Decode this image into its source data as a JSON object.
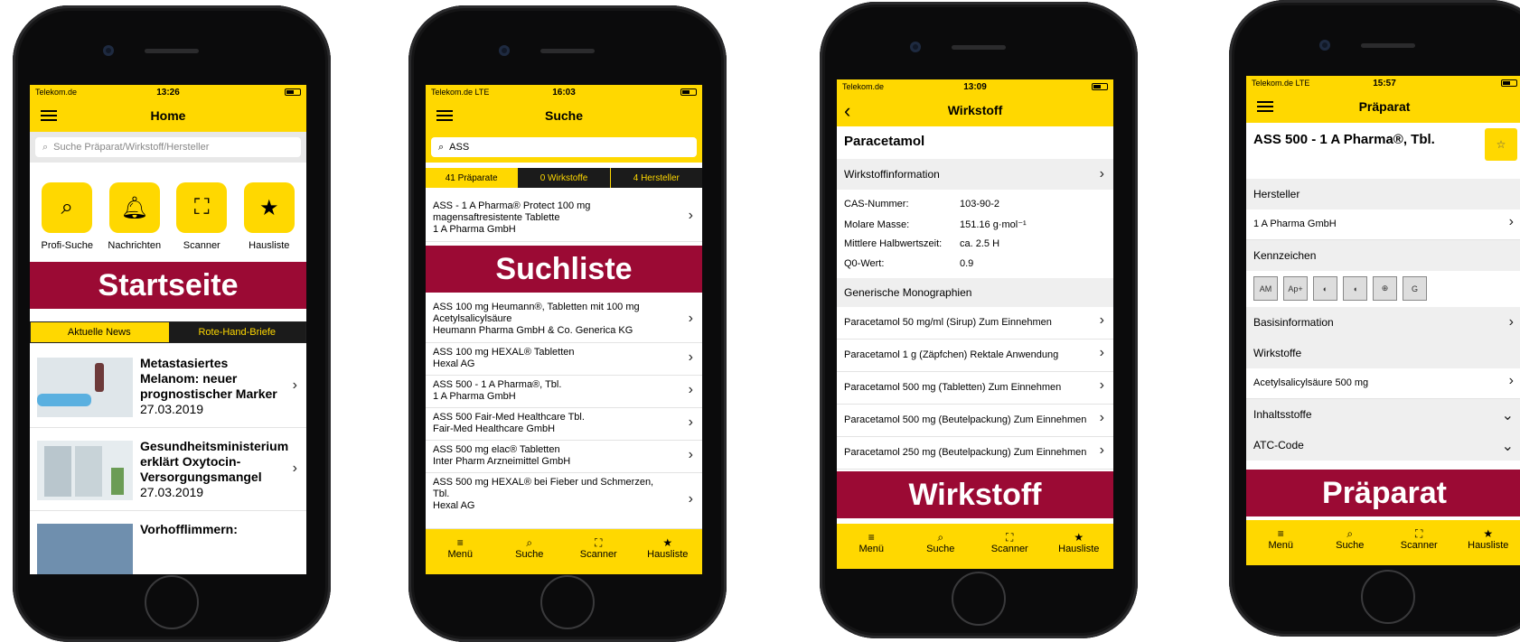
{
  "status": {
    "carrier": "Telekom.de",
    "network": "LTE"
  },
  "phones": [
    {
      "time": "13:26",
      "title": "Home"
    },
    {
      "time": "16:03",
      "title": "Suche"
    },
    {
      "time": "13:09",
      "title": "Wirkstoff"
    },
    {
      "time": "15:57",
      "title": "Präparat"
    }
  ],
  "home": {
    "search_placeholder": "Suche Präparat/Wirkstoff/Hersteller",
    "quick": [
      {
        "label": "Profi-Suche",
        "icon": "magnifier-icon"
      },
      {
        "label": "Nachrichten",
        "icon": "bell-icon"
      },
      {
        "label": "Scanner",
        "icon": "scan-frame-icon"
      },
      {
        "label": "Hausliste",
        "icon": "star-icon"
      }
    ],
    "banner": "Startseite",
    "segment": [
      "Aktuelle News",
      "Rote-Hand-Briefe"
    ],
    "news": [
      {
        "title": "Metastasiertes Melanom: neuer prognostischer Marker",
        "date": "27.03.2019"
      },
      {
        "title": "Gesundheitsministerium erklärt Oxytocin-Versorgungsmangel",
        "date": "27.03.2019"
      },
      {
        "title": "Vorhofflimmern:",
        "date": ""
      }
    ]
  },
  "suche": {
    "query": "ASS",
    "tabs": [
      "41 Präparate",
      "0 Wirkstoffe",
      "4 Hersteller"
    ],
    "banner": "Suchliste",
    "first": [
      "ASS - 1 A Pharma® Protect 100 mg",
      "magensaftresistente Tablette",
      "1 A Pharma GmbH"
    ],
    "results": [
      [
        "ASS 100 mg Heumann®, Tabletten mit 100 mg",
        "Acetylsalicylsäure",
        "Heumann Pharma GmbH & Co. Generica KG"
      ],
      [
        "ASS 100 mg HEXAL® Tabletten",
        "Hexal AG"
      ],
      [
        "ASS 500 - 1 A Pharma®, Tbl.",
        "1 A Pharma GmbH"
      ],
      [
        "ASS 500 Fair-Med Healthcare Tbl.",
        "Fair-Med Healthcare GmbH"
      ],
      [
        "ASS 500 mg elac® Tabletten",
        "Inter Pharm Arzneimittel GmbH"
      ],
      [
        "ASS 500 mg HEXAL® bei Fieber und Schmerzen,",
        "Tbl.",
        "Hexal AG"
      ]
    ]
  },
  "tabbar": [
    "Menü",
    "Suche",
    "Scanner",
    "Hausliste"
  ],
  "wirkstoff": {
    "name": "Paracetamol",
    "info_header": "Wirkstoffinformation",
    "props": [
      {
        "k": "CAS-Nummer:",
        "v": "103-90-2"
      },
      {
        "k": "Molare Masse:",
        "v": "151.16 g·mol⁻¹"
      },
      {
        "k": "Mittlere Halbwertszeit:",
        "v": "ca. 2.5 H"
      },
      {
        "k": "Q0-Wert:",
        "v": "0.9"
      }
    ],
    "mono_header": "Generische Monographien",
    "monos": [
      "Paracetamol 50 mg/ml (Sirup) Zum Einnehmen",
      "Paracetamol 1 g (Zäpfchen) Rektale Anwendung",
      "Paracetamol 500 mg (Tabletten) Zum Einnehmen",
      "Paracetamol 500 mg (Beutelpackung) Zum Einnehmen",
      "Paracetamol 250 mg (Beutelpackung) Zum Einnehmen"
    ],
    "banner": "Wirkstoff"
  },
  "praeparat": {
    "name": "ASS 500 - 1 A Pharma®, Tbl.",
    "hersteller_header": "Hersteller",
    "hersteller": "1 A Pharma GmbH",
    "kennzeichen_header": "Kennzeichen",
    "badges": [
      "AM",
      "Ap+",
      "",
      "",
      "",
      "G"
    ],
    "basis": "Basisinformation",
    "wirkstoffe_header": "Wirkstoffe",
    "wirkstoff": "Acetylsalicylsäure 500 mg",
    "inhalt": "Inhaltsstoffe",
    "atc": "ATC-Code",
    "banner": "Präparat"
  }
}
